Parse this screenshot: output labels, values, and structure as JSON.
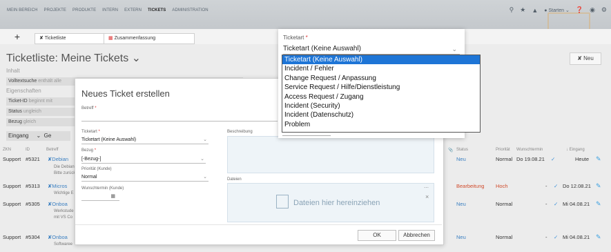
{
  "topnav": {
    "items": [
      "MEIN BEREICH",
      "PROJEKTE",
      "PRODUKTE",
      "INTERN",
      "EXTERN",
      "TICKETS",
      "ADMINISTRATION"
    ],
    "active": "TICKETS",
    "start_label": "Starten"
  },
  "tabs": {
    "new_tab": "+",
    "ticketliste": "Ticketliste",
    "zusammenfassung": "Zusammenfassung"
  },
  "page": {
    "title": "Ticketliste: Meine Tickets",
    "new_button": "Neu"
  },
  "filters": {
    "inhalt_label": "Inhalt",
    "volltext_field": "Volltextsuche",
    "volltext_op": "enthält alle",
    "eigenschaften_label": "Eigenschaften",
    "ticketid_field": "Ticket-ID",
    "ticketid_op": "beginnt mit",
    "status_field": "Status",
    "status_op": "ungleich",
    "bezug_field": "Bezug",
    "bezug_op": "gleich",
    "eingang": "Eingang",
    "eingang_next": "Ge"
  },
  "table": {
    "headers": {
      "zkn": "ZKN",
      "id": "ID",
      "betreff": "Betreff",
      "status": "Status",
      "prioritaet": "Priorität",
      "wunschtermin": "Wunschtermin",
      "eingang": "↓ Eingang"
    },
    "rows": [
      {
        "zkn": "Support",
        "id": "#5321",
        "betreff": "Debian",
        "sub1": "Die Debian",
        "sub2": "Bitte zurück",
        "status": "Neu",
        "prio": "Normal",
        "wunsch": "Do 19.08.21",
        "eingang": "Heute"
      },
      {
        "zkn": "Support",
        "id": "#5313",
        "betreff": "Micros",
        "sub1": "Wichtige E",
        "sub2": "",
        "status": "Bearbeitung",
        "prio": "Hoch",
        "wunsch": "-",
        "eingang": "Do 12.08.21"
      },
      {
        "zkn": "Support",
        "id": "#5305",
        "betreff": "Onboa",
        "sub1": "Werkstude",
        "sub2": "mit VS Co",
        "status": "Neu",
        "prio": "Normal",
        "wunsch": "-",
        "eingang": "Mi 04.08.21"
      },
      {
        "zkn": "Support",
        "id": "#5304",
        "betreff": "Onboa",
        "sub1": "Softwaree",
        "sub2": "",
        "status": "Neu",
        "prio": "Normal",
        "wunsch": "-",
        "eingang": "Mi 04.08.21"
      }
    ]
  },
  "modal": {
    "title": "Neues Ticket erstellen",
    "betreff_label": "Betreff",
    "ticketart_label": "Ticketart",
    "ticketart_value": "Ticketart (Keine Auswahl)",
    "bezug_label": "Bezug",
    "bezug_value": "[-Bezug-]",
    "prioritaet_label": "Priorität (Kunde)",
    "prioritaet_value": "Normal",
    "wunschtermin_label": "Wunschtermin (Kunde)",
    "beschreibung_label": "Beschreibung",
    "dateien_label": "Dateien",
    "dropzone_text": "Dateien hier hereinziehen",
    "ok_label": "OK",
    "cancel_label": "Abbrechen"
  },
  "popup": {
    "label": "Ticketart",
    "selected": "Ticketart (Keine Auswahl)",
    "options": [
      "Ticketart (Keine Auswahl)",
      "Incident / Fehler",
      "Change Request / Anpassung",
      "Service Request / Hilfe/Dienstleistung",
      "Access Request / Zugang",
      "Incident (Security)",
      "Incident (Datenschutz)",
      "Problem"
    ],
    "highlighted_index": 0
  },
  "colors": {
    "accent": "#1e75d6",
    "link": "#3a7fc1",
    "status_bearbeitung": "#d04a2a",
    "required": "#dd3333"
  }
}
